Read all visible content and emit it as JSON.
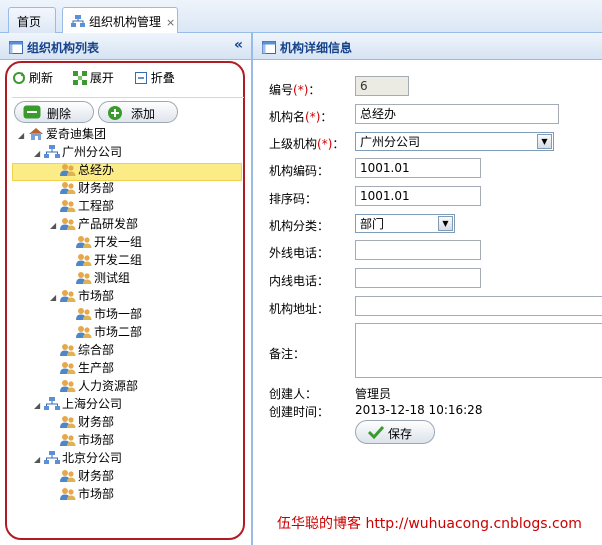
{
  "tabs": {
    "home": "首页",
    "org": "组织机构管理",
    "close": "×"
  },
  "left_panel": {
    "title": "组织机构列表",
    "collapse_icon": "double-left-chevron-icon"
  },
  "toolbar": {
    "refresh": "刷新",
    "expand": "展开",
    "collapse": "折叠",
    "delete": "删除",
    "add": "添加"
  },
  "tree": {
    "root": "爱奇迪集团",
    "gz": "广州分公司",
    "gz_zjb": "总经办",
    "gz_cwb": "财务部",
    "gz_gcb": "工程部",
    "gz_cpyfb": "产品研发部",
    "gz_kf1": "开发一组",
    "gz_kf2": "开发二组",
    "gz_cs": "测试组",
    "gz_scb": "市场部",
    "gz_sc1": "市场一部",
    "gz_sc2": "市场二部",
    "gz_zhb": "综合部",
    "gz_scb2": "生产部",
    "gz_rlzyb": "人力资源部",
    "sh": "上海分公司",
    "sh_cwb": "财务部",
    "sh_scb": "市场部",
    "bj": "北京分公司",
    "bj_cwb": "财务部",
    "bj_scb": "市场部"
  },
  "right_panel": {
    "title": "机构详细信息"
  },
  "form": {
    "id_label": "编号",
    "id_value": "6",
    "name_label": "机构名",
    "name_value": "总经办",
    "parent_label": "上级机构",
    "parent_value": "广州分公司",
    "code_label": "机构编码",
    "code_value": "1001.01",
    "sort_label": "排序码",
    "sort_value": "1001.01",
    "category_label": "机构分类：",
    "category_value": "部门",
    "ext_phone_label": "外线电话：",
    "ext_phone_value": "",
    "int_phone_label": "内线电话：",
    "int_phone_value": "",
    "address_label": "机构地址：",
    "address_value": "",
    "remark_label": "备注：",
    "remark_value": "",
    "creator_label": "创建人：",
    "creator_value": "管理员",
    "created_label": "创建时间：",
    "created_value": "2013-12-18 10:16:28",
    "req_mark": "(*)",
    "colon": "：",
    "save_label": "保存"
  },
  "watermark": "伍华聪的博客 http://wuhuacong.cnblogs.com"
}
